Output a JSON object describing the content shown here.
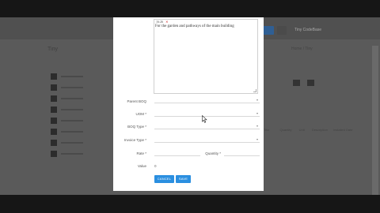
{
  "background": {
    "page_title": "Tiny",
    "breadcrumb": "Home / Tiny",
    "header_buttons": [
      "",
      ""
    ],
    "brand": "Tiny CodeBase",
    "table_headers": [
      "Title",
      "Quantity",
      "Unit",
      "Description",
      "Installed Date"
    ]
  },
  "modal": {
    "textarea": {
      "header": "16:26",
      "value": "For the garden and pathways of the main building"
    },
    "fields": {
      "parent_boq": {
        "label": "Parent BOQ",
        "value": ""
      },
      "uom": {
        "label": "UOM *",
        "value": ""
      },
      "boq_type": {
        "label": "BOQ Type *",
        "value": ""
      },
      "invoice_type": {
        "label": "Invoice Type *",
        "value": ""
      },
      "rate": {
        "label": "Rate *",
        "value": ""
      },
      "quantity": {
        "label": "Quantity *",
        "value": ""
      },
      "value": {
        "label": "Value",
        "value": "0"
      }
    },
    "buttons": {
      "cancel": "CANCEL",
      "save": "SAVE"
    }
  },
  "colors": {
    "primary_button": "#2b8fe0",
    "overlay": "#5a5a5a"
  },
  "icons": {
    "select_chevron": "chevron-down-icon",
    "textarea_close": "close-icon"
  }
}
